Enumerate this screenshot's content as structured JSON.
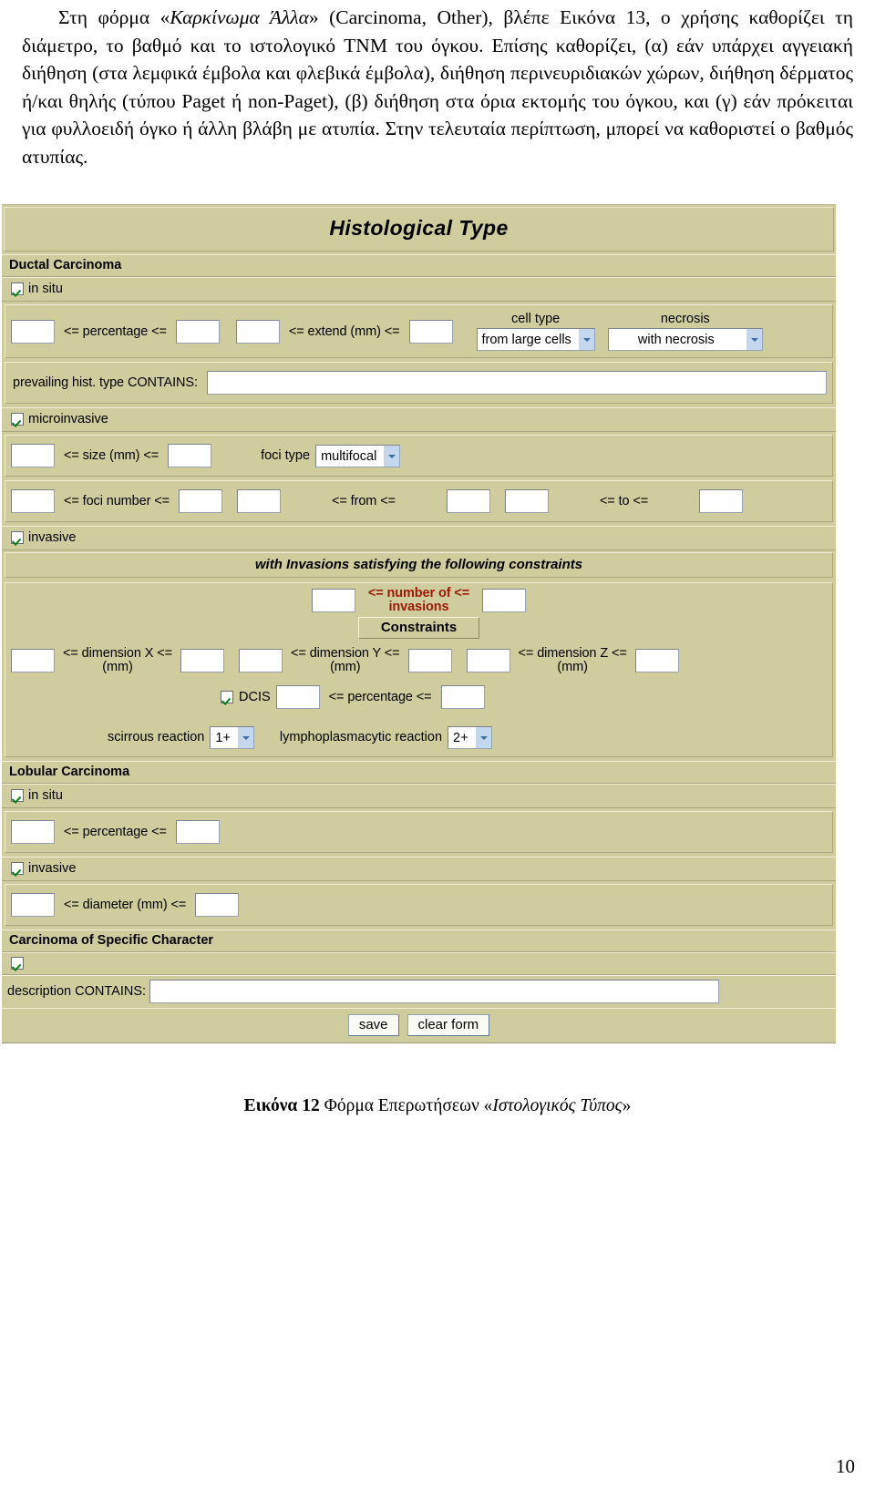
{
  "body_text": {
    "paragraph_plain_1": "Στη φόρμα «",
    "paragraph_italic_1": "Καρκίνωμα Άλλα",
    "paragraph_plain_2": "» (Carcinoma, Other), βλέπε Εικόνα 13, ο χρήσης καθορίζει τη διάμετρο, το βαθμό και το ιστολογικό TNM του όγκου. Επίσης καθορίζει, (α) εάν υπάρχει αγγειακή διήθηση (στα λεμφικά έμβολα και φλεβικά έμβολα), διήθηση περινευριδιακών χώρων, διήθηση δέρματος ή/και θηλής (τύπου Paget ή non-Paget), (β) διήθηση στα όρια εκτομής του όγκου, και (γ) εάν πρόκειται για φυλλοειδή όγκο ή άλλη βλάβη με ατυπία. Στην τελευταία περίπτωση, μπορεί να καθοριστεί ο βαθμός ατυπίας."
  },
  "form": {
    "title": "Histological Type",
    "ductal": {
      "section_label": "Ductal Carcinoma",
      "in_situ": {
        "checkbox_label": "in situ",
        "checked": true,
        "percentage_label": "<= percentage <=",
        "percentage_min": "",
        "percentage_max": "",
        "extend_label": "<= extend (mm) <=",
        "extend_min": "",
        "extend_max": "",
        "cell_type_label": "cell type",
        "cell_type_value": "from large cells",
        "necrosis_label": "necrosis",
        "necrosis_value": "with necrosis",
        "prevailing_label": "prevailing hist. type CONTAINS:",
        "prevailing_value": ""
      },
      "microinvasive": {
        "checkbox_label": "microinvasive",
        "checked": true,
        "size_label": "<= size (mm) <=",
        "size_min": "",
        "size_max": "",
        "foci_type_label": "foci type",
        "foci_type_value": "multifocal",
        "foci_number_label": "<= foci number <=",
        "foci_number_min": "",
        "foci_number_max": "",
        "from_label": "<= from <=",
        "from_min": "",
        "from_max": "",
        "to_label": "<= to <=",
        "to_min": "",
        "to_max": ""
      },
      "invasive": {
        "checkbox_label": "invasive",
        "checked": true,
        "subheader": "with Invasions satisfying the following constraints",
        "number_of_label_line1": "<= number of <=",
        "number_of_label_line2": "invasions",
        "number_min": "",
        "number_max": "",
        "constraints_label": "Constraints",
        "dim_x_line1": "<= dimension X <=",
        "dim_x_line2": "(mm)",
        "dim_x_min": "",
        "dim_x_max": "",
        "dim_y_line1": "<= dimension Y <=",
        "dim_y_line2": "(mm)",
        "dim_y_min": "",
        "dim_y_max": "",
        "dim_z_line1": "<= dimension Z <=",
        "dim_z_line2": "(mm)",
        "dim_z_min": "",
        "dim_z_max": "",
        "dcis_label": "DCIS",
        "dcis_checked": true,
        "dcis_percentage_label": "<= percentage <=",
        "dcis_pct_min": "",
        "dcis_pct_max": "",
        "scirrous_label": "scirrous reaction",
        "scirrous_value": "1+",
        "lympho_label": "lymphoplasmacytic reaction",
        "lympho_value": "2+"
      }
    },
    "lobular": {
      "section_label": "Lobular Carcinoma",
      "in_situ_label": "in situ",
      "in_situ_checked": true,
      "percentage_label": "<= percentage <=",
      "percentage_min": "",
      "percentage_max": "",
      "invasive_label": "invasive",
      "invasive_checked": true,
      "diameter_label": "<= diameter (mm) <=",
      "diameter_min": "",
      "diameter_max": ""
    },
    "specific": {
      "section_label": "Carcinoma of Specific Character",
      "checkbox_label": "",
      "checked": true,
      "description_label": "description CONTAINS:",
      "description_value": ""
    },
    "buttons": {
      "save": "save",
      "clear": "clear form"
    },
    "colors": {
      "background": "#cfcc9d",
      "field": "#ffffff",
      "accent_red": "#9c1a06",
      "dropdown_arrow": "#c3d8ee",
      "check_green": "#0b7a1c"
    }
  },
  "caption": {
    "bold": "Εικόνα 12",
    "normal": " Φόρμα Επερωτήσεων «",
    "italic": "Ιστολογικός Τύπος",
    "tail": "»"
  },
  "page_number": "10"
}
